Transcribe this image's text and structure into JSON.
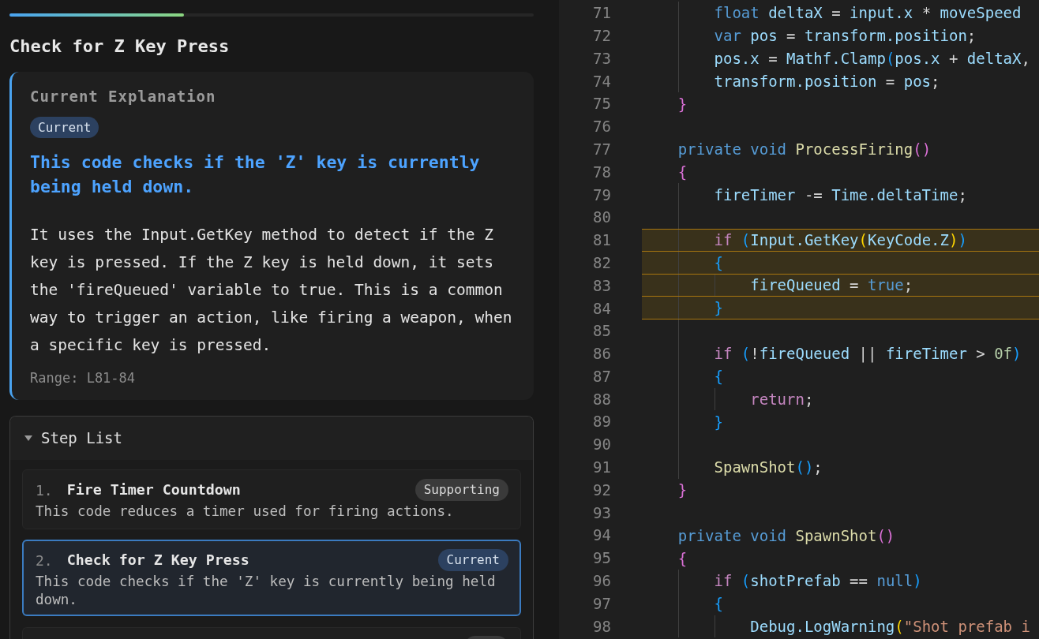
{
  "progress": {
    "level": 0.333
  },
  "title": "Check for Z Key Press",
  "explanation": {
    "heading": "Current Explanation",
    "badge": {
      "text": "Current",
      "kind": "current"
    },
    "summary": "This code checks if the 'Z' key is currently being held down.",
    "body": "It uses the Input.GetKey method to detect if the Z key is pressed. If the Z key is held down, it sets the 'fireQueued' variable to true. This is a common way to trigger an action, like firing a weapon, when a specific key is pressed.",
    "range": "Range: L81-84"
  },
  "step_list": {
    "title": "Step List",
    "expanded": true,
    "steps": [
      {
        "number": "1.",
        "title": "Fire Timer Countdown",
        "description": "This code reduces a timer used for firing actions.",
        "badge": {
          "text": "Supporting",
          "kind": "supporting"
        },
        "selected": false
      },
      {
        "number": "2.",
        "title": "Check for Z Key Press",
        "description": "This code checks if the 'Z' key is currently being held down.",
        "badge": {
          "text": "Current",
          "kind": "current"
        },
        "selected": true
      }
    ],
    "more_below": true
  },
  "editor": {
    "lines": [
      {
        "children": [
          {
            "number": "71",
            "highlighted": false,
            "tokens": [
              {
                "text": "float ",
                "kind": "keyword"
              },
              {
                "text": "deltaX",
                "kind": "variable"
              },
              {
                "text": " = ",
                "kind": "operator"
              },
              {
                "text": "input.x",
                "kind": "variable"
              },
              {
                "text": " * ",
                "kind": "operator"
              },
              {
                "text": "moveSpeed",
                "kind": "variable"
              }
            ]
          },
          {
            "number": "72",
            "highlighted": false,
            "tokens": [
              {
                "text": "var ",
                "kind": "keyword"
              },
              {
                "text": "pos",
                "kind": "variable"
              },
              {
                "text": " = ",
                "kind": "operator"
              },
              {
                "text": "transform.position",
                "kind": "variable"
              },
              {
                "text": ";",
                "kind": "punct"
              }
            ]
          },
          {
            "number": "73",
            "highlighted": false,
            "tokens": [
              {
                "text": "pos.x",
                "kind": "variable"
              },
              {
                "text": " = ",
                "kind": "operator"
              },
              {
                "text": "Mathf.Clamp",
                "kind": "variable"
              },
              {
                "text": "(",
                "kind": "bracket3"
              },
              {
                "text": "pos.x",
                "kind": "variable"
              },
              {
                "text": " + ",
                "kind": "operator"
              },
              {
                "text": "deltaX",
                "kind": "variable"
              },
              {
                "text": ",",
                "kind": "punct"
              }
            ]
          },
          {
            "number": "74",
            "highlighted": false,
            "tokens": [
              {
                "text": "transform.position",
                "kind": "variable"
              },
              {
                "text": " = ",
                "kind": "operator"
              },
              {
                "text": "pos",
                "kind": "variable"
              },
              {
                "text": ";",
                "kind": "punct"
              }
            ]
          }
        ]
      },
      {
        "number": "75",
        "highlighted": false,
        "tokens": [
          {
            "text": "}",
            "kind": "bracket2"
          }
        ]
      },
      {
        "number": "76",
        "highlighted": false
      },
      {
        "number": "77",
        "highlighted": false,
        "tokens": [
          {
            "text": "private void ",
            "kind": "keyword"
          },
          {
            "text": "ProcessFiring",
            "kind": "function"
          },
          {
            "text": "()",
            "kind": "bracket2"
          }
        ]
      },
      {
        "number": "78",
        "highlighted": false,
        "tokens": [
          {
            "text": "{",
            "kind": "bracket2"
          }
        ],
        "children": [
          {
            "number": "79",
            "highlighted": false,
            "tokens": [
              {
                "text": "fireTimer",
                "kind": "variable"
              },
              {
                "text": " -= ",
                "kind": "operator"
              },
              {
                "text": "Time.deltaTime",
                "kind": "variable"
              },
              {
                "text": ";",
                "kind": "punct"
              }
            ]
          },
          {
            "number": "80",
            "highlighted": false
          },
          {
            "number": "81",
            "highlighted": true,
            "tokens": [
              {
                "text": "if ",
                "kind": "control"
              },
              {
                "text": "(",
                "kind": "bracket3"
              },
              {
                "text": "Input.GetKey",
                "kind": "variable"
              },
              {
                "text": "(",
                "kind": "bracket1"
              },
              {
                "text": "KeyCode.Z",
                "kind": "variable"
              },
              {
                "text": ")",
                "kind": "bracket1"
              },
              {
                "text": ")",
                "kind": "bracket3"
              }
            ]
          },
          {
            "number": "82",
            "highlighted": true,
            "tokens": [
              {
                "text": "{",
                "kind": "bracket3"
              }
            ],
            "children": [
              {
                "number": "83",
                "highlighted": true,
                "tokens": [
                  {
                    "text": "fireQueued",
                    "kind": "variable"
                  },
                  {
                    "text": " = ",
                    "kind": "operator"
                  },
                  {
                    "text": "true",
                    "kind": "keyword"
                  },
                  {
                    "text": ";",
                    "kind": "punct"
                  }
                ]
              }
            ]
          },
          {
            "number": "84",
            "highlighted": true,
            "tokens": [
              {
                "text": "}",
                "kind": "bracket3"
              }
            ]
          },
          {
            "number": "85",
            "highlighted": false
          },
          {
            "number": "86",
            "highlighted": false,
            "tokens": [
              {
                "text": "if ",
                "kind": "control"
              },
              {
                "text": "(",
                "kind": "bracket3"
              },
              {
                "text": "!",
                "kind": "operator"
              },
              {
                "text": "fireQueued",
                "kind": "variable"
              },
              {
                "text": " || ",
                "kind": "operator"
              },
              {
                "text": "fireTimer",
                "kind": "variable"
              },
              {
                "text": " > ",
                "kind": "operator"
              },
              {
                "text": "0f",
                "kind": "number"
              },
              {
                "text": ")",
                "kind": "bracket3"
              }
            ]
          },
          {
            "number": "87",
            "highlighted": false,
            "tokens": [
              {
                "text": "{",
                "kind": "bracket3"
              }
            ],
            "children": [
              {
                "number": "88",
                "highlighted": false,
                "tokens": [
                  {
                    "text": "return",
                    "kind": "control"
                  },
                  {
                    "text": ";",
                    "kind": "punct"
                  }
                ]
              }
            ]
          },
          {
            "number": "89",
            "highlighted": false,
            "tokens": [
              {
                "text": "}",
                "kind": "bracket3"
              }
            ]
          },
          {
            "number": "90",
            "highlighted": false
          },
          {
            "number": "91",
            "highlighted": false,
            "tokens": [
              {
                "text": "SpawnShot",
                "kind": "function"
              },
              {
                "text": "()",
                "kind": "bracket3"
              },
              {
                "text": ";",
                "kind": "punct"
              }
            ]
          }
        ]
      },
      {
        "number": "92",
        "highlighted": false,
        "tokens": [
          {
            "text": "}",
            "kind": "bracket2"
          }
        ]
      },
      {
        "number": "93",
        "highlighted": false
      },
      {
        "number": "94",
        "highlighted": false,
        "tokens": [
          {
            "text": "private void ",
            "kind": "keyword"
          },
          {
            "text": "SpawnShot",
            "kind": "function"
          },
          {
            "text": "()",
            "kind": "bracket2"
          }
        ]
      },
      {
        "number": "95",
        "highlighted": false,
        "tokens": [
          {
            "text": "{",
            "kind": "bracket2"
          }
        ],
        "children": [
          {
            "number": "96",
            "highlighted": false,
            "tokens": [
              {
                "text": "if ",
                "kind": "control"
              },
              {
                "text": "(",
                "kind": "bracket3"
              },
              {
                "text": "shotPrefab",
                "kind": "variable"
              },
              {
                "text": " == ",
                "kind": "operator"
              },
              {
                "text": "null",
                "kind": "keyword"
              },
              {
                "text": ")",
                "kind": "bracket3"
              }
            ]
          },
          {
            "number": "97",
            "highlighted": false,
            "tokens": [
              {
                "text": "{",
                "kind": "bracket3"
              }
            ],
            "children": [
              {
                "number": "98",
                "highlighted": false,
                "tokens": [
                  {
                    "text": "Debug.LogWarning",
                    "kind": "variable"
                  },
                  {
                    "text": "(",
                    "kind": "bracket1"
                  },
                  {
                    "text": "\"Shot prefab i",
                    "kind": "string"
                  }
                ]
              }
            ]
          }
        ]
      }
    ]
  }
}
